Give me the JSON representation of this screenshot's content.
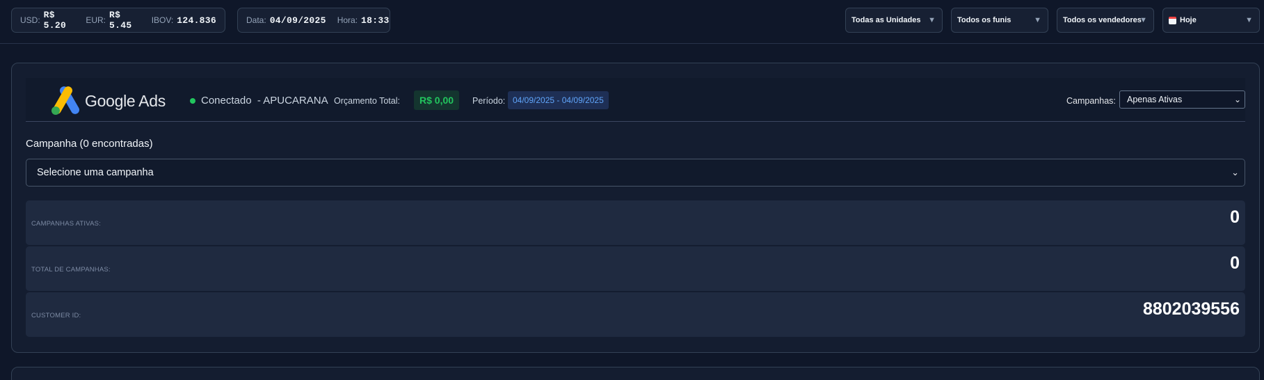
{
  "topbar": {
    "market": [
      {
        "label": "USD:",
        "value": "R$ 5.20"
      },
      {
        "label": "EUR:",
        "value": "R$ 5.45"
      },
      {
        "label": "IBOV:",
        "value": "124.836"
      }
    ],
    "date_label": "Data:",
    "date_value": "04/09/2025",
    "time_label": "Hora:",
    "time_value": "18:33",
    "filters": {
      "units": "Todas as Unidades",
      "funnels": "Todos os funis",
      "sellers": "Todos os vendedores",
      "period": "Hoje"
    }
  },
  "ads": {
    "brand": "Google Ads",
    "status": "Conectado  - APUCARANA",
    "budget_label": "Orçamento Total:",
    "budget_value": "R$ 0,00",
    "period_label": "Período:",
    "period_value": "04/09/2025 - 04/09/2025",
    "campaigns_filter_label": "Campanhas:",
    "campaigns_filter_value": "Apenas Ativas",
    "status_color": "#22c55e"
  },
  "campaign_section": {
    "title": "Campanha (0 encontradas)",
    "select_value": "Selecione uma campanha"
  },
  "metrics": [
    {
      "label": "CAMPANHAS ATIVAS:",
      "value": "0"
    },
    {
      "label": "TOTAL DE CAMPANHAS:",
      "value": "0"
    },
    {
      "label": "CUSTOMER ID:",
      "value": "8802039556"
    }
  ]
}
